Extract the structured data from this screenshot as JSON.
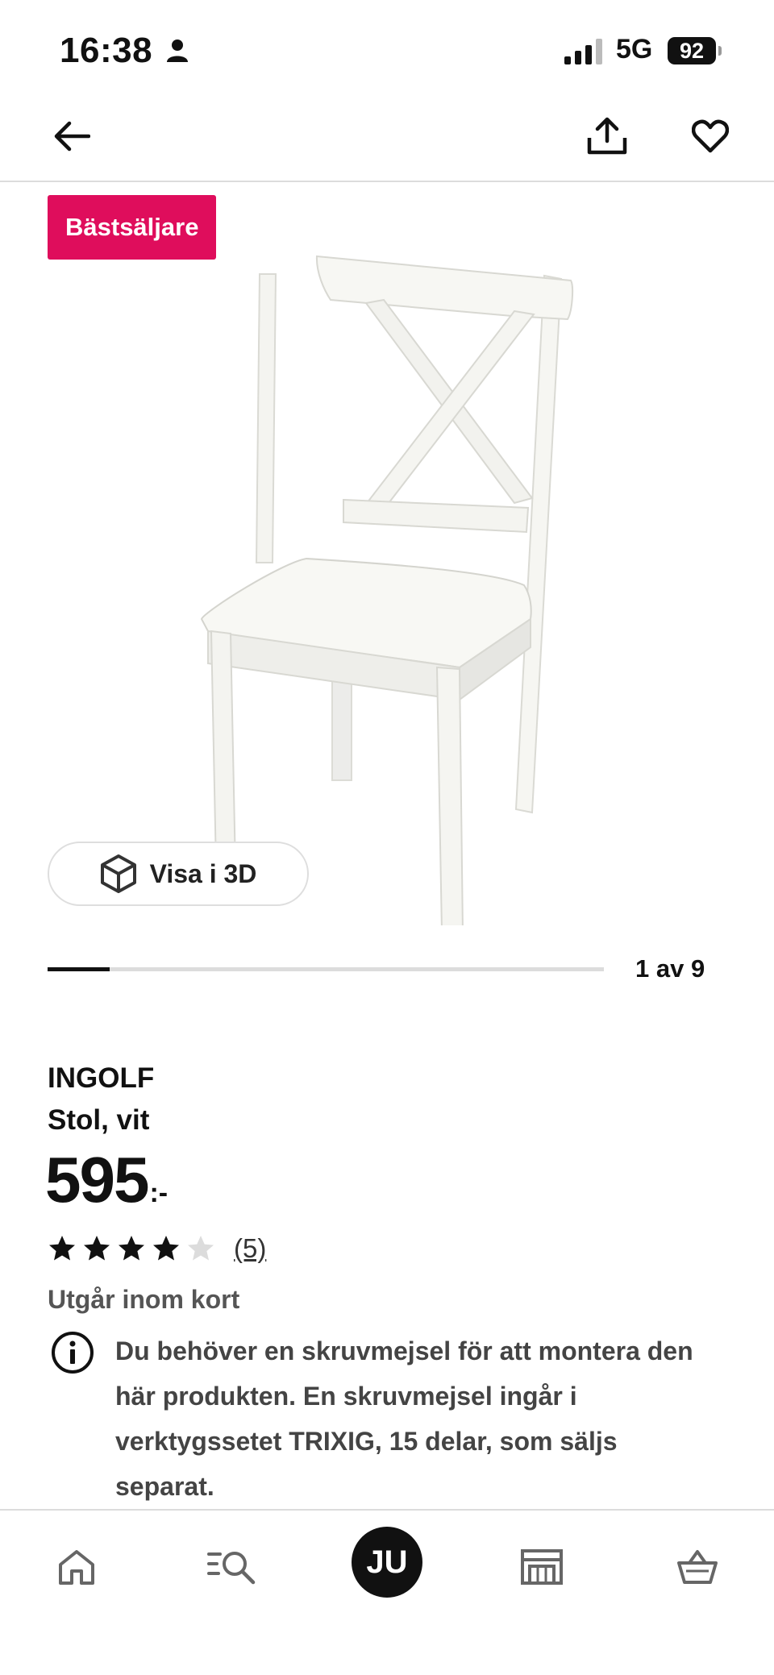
{
  "status_bar": {
    "time": "16:38",
    "network": "5G",
    "battery": "92"
  },
  "top_nav": {
    "back_icon": "arrow-left-icon",
    "share_icon": "share-icon",
    "favorite_icon": "heart-icon"
  },
  "media": {
    "badge": "Bästsäljare",
    "view_3d_label": "Visa i 3D",
    "counter": "1 av 9",
    "progress_fraction": 0.111
  },
  "product": {
    "name": "INGOLF",
    "description": "Stol, vit",
    "price": "595",
    "price_suffix": ":-",
    "rating": 4,
    "rating_max": 5,
    "review_count": "(5)",
    "stock_status": "Utgår inom kort",
    "notice": "Du behöver en skruvmejsel för att montera den här produkten. En skruvmejsel ingår i verktygssetet TRIXIG, 15 delar, som säljs separat."
  },
  "bottom_nav": {
    "items": [
      {
        "icon": "home-icon"
      },
      {
        "icon": "search-icon"
      },
      {
        "label": "JU"
      },
      {
        "icon": "store-icon"
      },
      {
        "icon": "cart-icon"
      }
    ]
  },
  "colors": {
    "badge": "#df0d5c",
    "text": "#111111",
    "muted": "#555555",
    "divider": "#dcdcdc"
  }
}
